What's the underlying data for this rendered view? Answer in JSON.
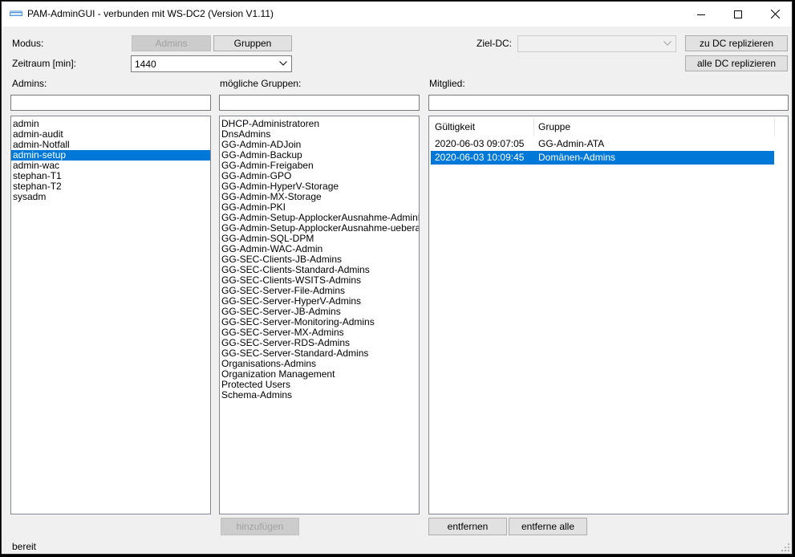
{
  "window": {
    "title": "PAM-AdminGUI - verbunden mit WS-DC2 (Version V1.11)"
  },
  "top": {
    "modus_label": "Modus:",
    "admins_button": "Admins",
    "gruppen_button": "Gruppen",
    "zeitraum_label": "Zeitraum [min]:",
    "zeitraum_value": "1440",
    "ziel_dc_label": "Ziel-DC:",
    "ziel_dc_value": "",
    "replicate_dc_button": "zu DC replizieren",
    "replicate_all_button": "alle DC replizieren"
  },
  "admins": {
    "label": "Admins:",
    "filter_value": "",
    "items": [
      "admin",
      "admin-audit",
      "admin-Notfall",
      "admin-setup",
      "admin-wac",
      "stephan-T1",
      "stephan-T2",
      "sysadm"
    ],
    "selected_index": 3
  },
  "groups": {
    "label": "mögliche Gruppen:",
    "filter_value": "",
    "items": [
      "DHCP-Administratoren",
      "DnsAdmins",
      "GG-Admin-ADJoin",
      "GG-Admin-Backup",
      "GG-Admin-Freigaben",
      "GG-Admin-GPO",
      "GG-Admin-HyperV-Storage",
      "GG-Admin-MX-Storage",
      "GG-Admin-PKI",
      "GG-Admin-Setup-ApplockerAusnahme-AdminDir",
      "GG-Admin-Setup-ApplockerAusnahme-ueberall",
      "GG-Admin-SQL-DPM",
      "GG-Admin-WAC-Admin",
      "GG-SEC-Clients-JB-Admins",
      "GG-SEC-Clients-Standard-Admins",
      "GG-SEC-Clients-WSITS-Admins",
      "GG-SEC-Server-File-Admins",
      "GG-SEC-Server-HyperV-Admins",
      "GG-SEC-Server-JB-Admins",
      "GG-SEC-Server-Monitoring-Admins",
      "GG-SEC-Server-MX-Admins",
      "GG-SEC-Server-RDS-Admins",
      "GG-SEC-Server-Standard-Admins",
      "Organisations-Admins",
      "Organization Management",
      "Protected Users",
      "Schema-Admins"
    ],
    "add_button": "hinzufügen"
  },
  "member": {
    "label": "Mitglied:",
    "filter_value": "",
    "columns": [
      "Gültigkeit",
      "Gruppe"
    ],
    "rows": [
      [
        "2020-06-03 09:07:05",
        "GG-Admin-ATA"
      ],
      [
        "2020-06-03 10:09:45",
        "Domänen-Admins"
      ]
    ],
    "selected_index": 1,
    "remove_button": "entfernen",
    "remove_all_button": "entferne alle"
  },
  "status": {
    "text": "bereit"
  },
  "colors": {
    "selection": "#0078d7",
    "window_bg": "#f0f0f0"
  }
}
